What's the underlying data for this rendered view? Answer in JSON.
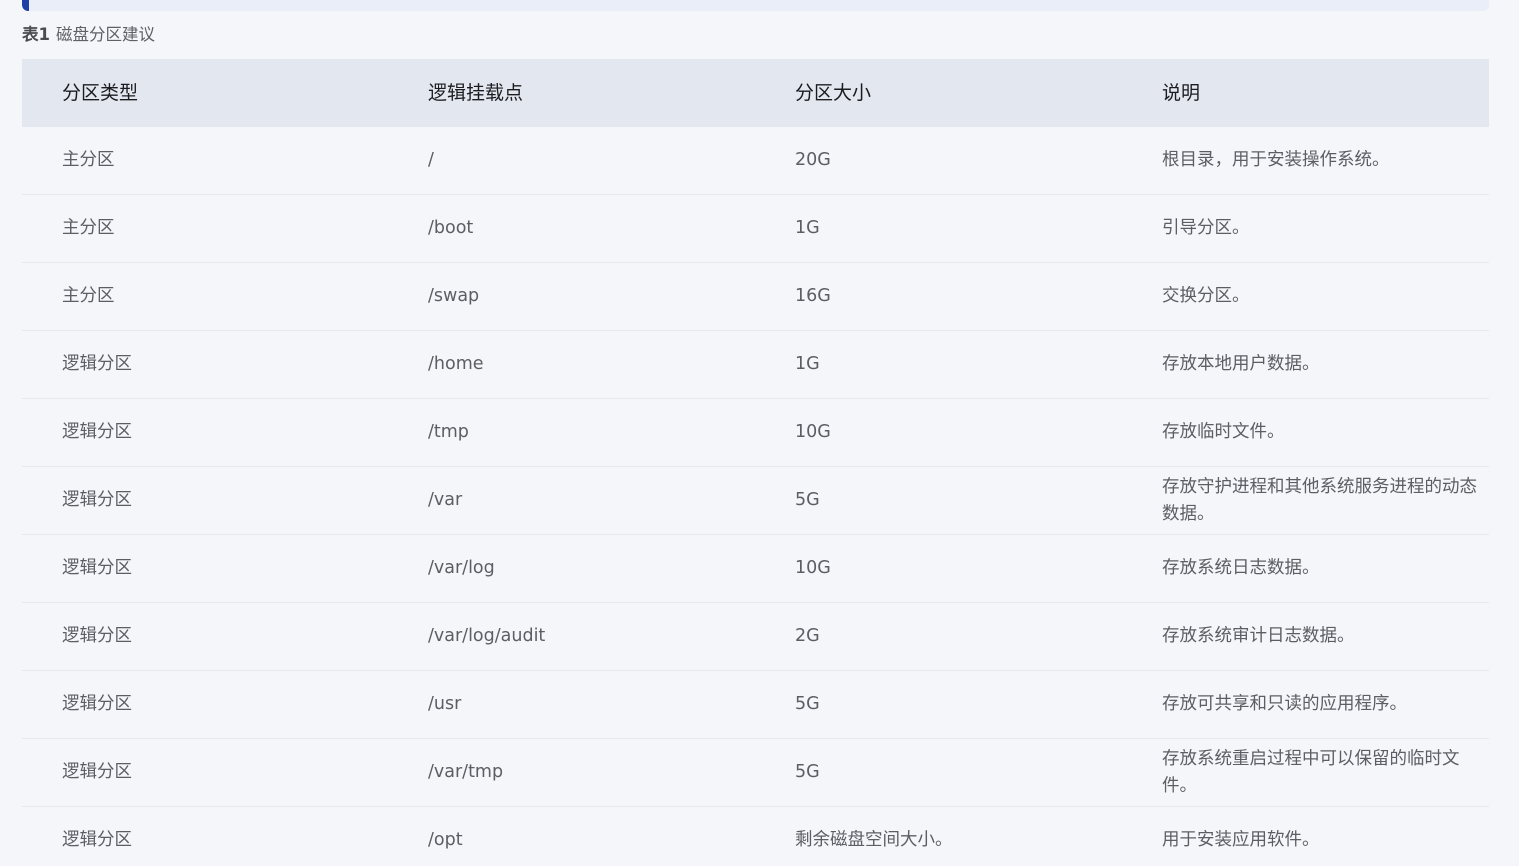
{
  "caption": {
    "number": "表1",
    "title": "磁盘分区建议"
  },
  "table": {
    "headers": [
      "分区类型",
      "逻辑挂载点",
      "分区大小",
      "说明"
    ],
    "rows": [
      [
        "主分区",
        "/",
        "20G",
        "根目录，用于安装操作系统。"
      ],
      [
        "主分区",
        "/boot",
        "1G",
        "引导分区。"
      ],
      [
        "主分区",
        "/swap",
        "16G",
        "交换分区。"
      ],
      [
        "逻辑分区",
        "/home",
        "1G",
        "存放本地用户数据。"
      ],
      [
        "逻辑分区",
        "/tmp",
        "10G",
        "存放临时文件。"
      ],
      [
        "逻辑分区",
        "/var",
        "5G",
        "存放守护进程和其他系统服务进程的动态数据。"
      ],
      [
        "逻辑分区",
        "/var/log",
        "10G",
        "存放系统日志数据。"
      ],
      [
        "逻辑分区",
        "/var/log/audit",
        "2G",
        "存放系统审计日志数据。"
      ],
      [
        "逻辑分区",
        "/usr",
        "5G",
        "存放可共享和只读的应用程序。"
      ],
      [
        "逻辑分区",
        "/var/tmp",
        "5G",
        "存放系统重启过程中可以保留的临时文件。"
      ],
      [
        "逻辑分区",
        "/opt",
        "剩余磁盘空间大小。",
        "用于安装应用软件。"
      ]
    ]
  },
  "colors": {
    "background": "#f4f6f9",
    "header_background": "#e3e7ef",
    "accent": "#1d3fa6"
  }
}
